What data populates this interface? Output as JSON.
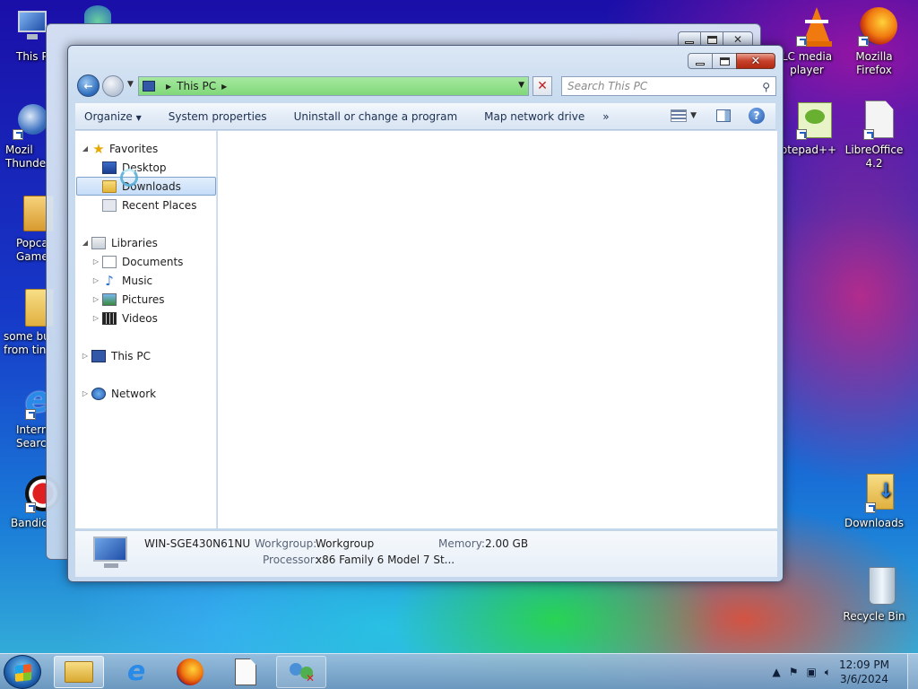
{
  "desktop": {
    "icons_left": [
      {
        "label": "This P",
        "name": "desktop-icon-this-pc"
      },
      {
        "label": "Mozil\nThunde",
        "name": "desktop-icon-thunderbird"
      },
      {
        "label": "Popca\nGame",
        "name": "desktop-icon-popcap-games"
      },
      {
        "label": "some bu\nfrom tin",
        "name": "desktop-icon-some-folder"
      },
      {
        "label": "Intern\nSearc",
        "name": "desktop-icon-internet-explorer"
      },
      {
        "label": "Bandic",
        "name": "desktop-icon-bandicam"
      }
    ],
    "icons_right": [
      {
        "label": "LC media\nplayer",
        "name": "desktop-icon-vlc"
      },
      {
        "label": "Mozilla\nFirefox",
        "name": "desktop-icon-firefox"
      },
      {
        "label": "otepad++",
        "name": "desktop-icon-notepadpp"
      },
      {
        "label": "LibreOffice\n4.2",
        "name": "desktop-icon-libreoffice"
      },
      {
        "label": "Downloads",
        "name": "desktop-icon-downloads"
      },
      {
        "label": "Recycle Bin",
        "name": "desktop-icon-recycle-bin"
      }
    ]
  },
  "explorer": {
    "address": {
      "location": "This PC"
    },
    "search": {
      "placeholder": "Search This PC"
    },
    "toolbar": {
      "organize": "Organize",
      "system_properties": "System properties",
      "uninstall": "Uninstall or change a program",
      "map_drive": "Map network drive",
      "more": "»"
    },
    "nav_pane": {
      "favorites": "Favorites",
      "desktop": "Desktop",
      "downloads": "Downloads",
      "recent_places": "Recent Places",
      "libraries": "Libraries",
      "documents": "Documents",
      "music": "Music",
      "pictures": "Pictures",
      "videos": "Videos",
      "this_pc": "This PC",
      "network": "Network"
    },
    "details": {
      "computer_name": "WIN-SGE430N61NU",
      "workgroup_label": "Workgroup:",
      "workgroup_value": "Workgroup",
      "memory_label": "Memory:",
      "memory_value": "2.00 GB",
      "processor_label": "Processor:",
      "processor_value": "x86 Family 6 Model 7 St..."
    }
  },
  "taskbar": {
    "clock_time": "12:09 PM",
    "clock_date": "3/6/2024"
  },
  "colors": {
    "address_bar_fill": "#8fdc88",
    "selection": "#c6ddf8",
    "close_button": "#c7402a"
  }
}
